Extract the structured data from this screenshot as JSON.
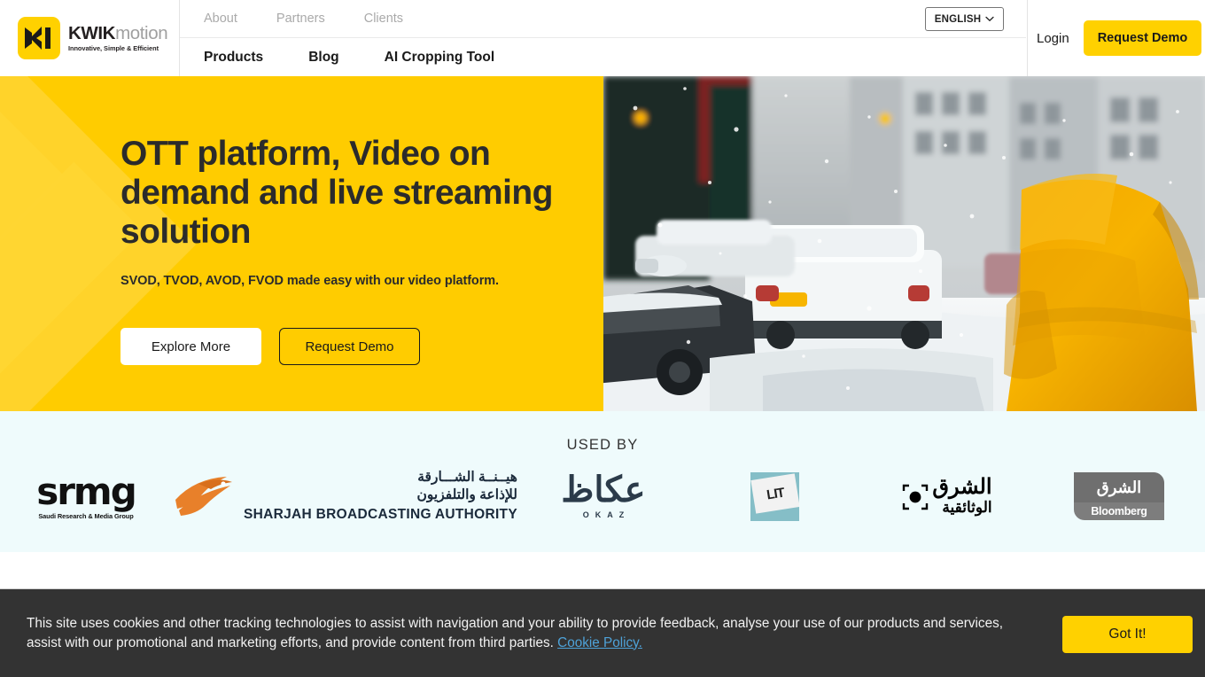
{
  "brand": {
    "logo_word_bold": "KWIK",
    "logo_word_light": "motion",
    "logo_tagline": "Innovative, Simple & Efficient",
    "logo_icon": "kwikmotion-k-mark",
    "yellow": "#ffd100",
    "hero_yellow": "#ffcc00",
    "dark": "#2b2b2b"
  },
  "header": {
    "nav_top": [
      {
        "label": "About"
      },
      {
        "label": "Partners"
      },
      {
        "label": "Clients"
      }
    ],
    "nav_bottom": [
      {
        "label": "Products"
      },
      {
        "label": "Blog"
      },
      {
        "label": "AI Cropping Tool"
      }
    ],
    "language": {
      "value": "ENGLISH",
      "caret_icon": "chevron-down-icon",
      "caret": "⌄"
    },
    "login_label": "Login",
    "demo_label": "Request Demo"
  },
  "hero": {
    "title": "OTT platform, Video on demand and live streaming solution",
    "subtitle": "SVOD, TVOD, AVOD, FVOD made easy with our video platform.",
    "primary_button": "Explore More",
    "secondary_button": "Request Demo",
    "image_alt": "Person in yellow raincoat walking on snowy city street with snow-covered cars"
  },
  "used_by": {
    "title": "USED BY",
    "background": "#effbfc",
    "logos": [
      {
        "name": "srmg",
        "word": "srmg",
        "subtitle": "Saudi Research & Media Group"
      },
      {
        "name": "sharjah-broadcasting-authority",
        "arabic_line1": "هيــنــة الشـــارقة",
        "arabic_line2": "للإذاعة والتلفزيون",
        "english": "SHARJAH BROADCASTING AUTHORITY"
      },
      {
        "name": "okaz",
        "arabic": "عكاظ",
        "english": "OKAZ"
      },
      {
        "name": "lit",
        "text": "LIT"
      },
      {
        "name": "asharq-documentary",
        "arabic_line1": "الشرق",
        "arabic_line2": "الوثائقية"
      },
      {
        "name": "asharq-with-bloomberg",
        "arabic": "الشرق",
        "english": "Bloomberg"
      }
    ]
  },
  "cookie_banner": {
    "text_part1": "This site uses cookies and other tracking technologies to assist with navigation and your ability to provide feedback, analyse your use of our products and services, assist with our promotional and marketing efforts, and provide content from third parties. ",
    "link_label": "Cookie Policy.",
    "accept_label": "Got It!"
  }
}
